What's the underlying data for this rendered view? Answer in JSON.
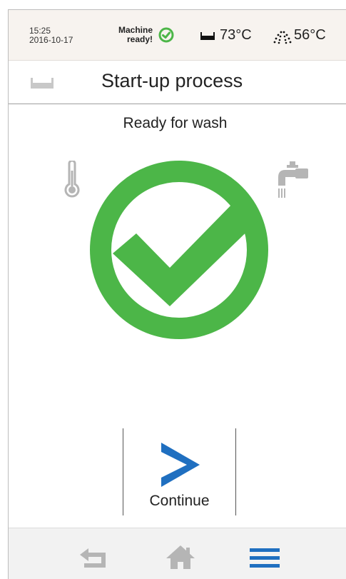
{
  "status_bar": {
    "time": "15:25",
    "date": "2016-10-17",
    "machine_status_line1": "Machine",
    "machine_status_line2": "ready!",
    "tank_temperature": "73°C",
    "rinse_temperature": "56°C",
    "status_icon": "check-circle-icon",
    "tank_icon": "tank-icon",
    "rinse_icon": "rinse-spray-icon"
  },
  "header": {
    "icon": "tank-icon",
    "title": "Start-up process"
  },
  "main": {
    "status_message": "Ready for wash",
    "left_icon": "thermometer-icon",
    "right_icon": "faucet-icon",
    "center_icon": "large-check-circle-icon",
    "continue_label": "Continue",
    "continue_icon": "chevron-right-icon"
  },
  "bottom_nav": {
    "items": [
      "back-icon",
      "home-icon",
      "menu-icon"
    ]
  },
  "colors": {
    "accent_green": "#4cb648",
    "accent_blue": "#1f6fc0",
    "icon_gray": "#b5b5b5",
    "status_bar_bg": "#f7f3ef"
  }
}
